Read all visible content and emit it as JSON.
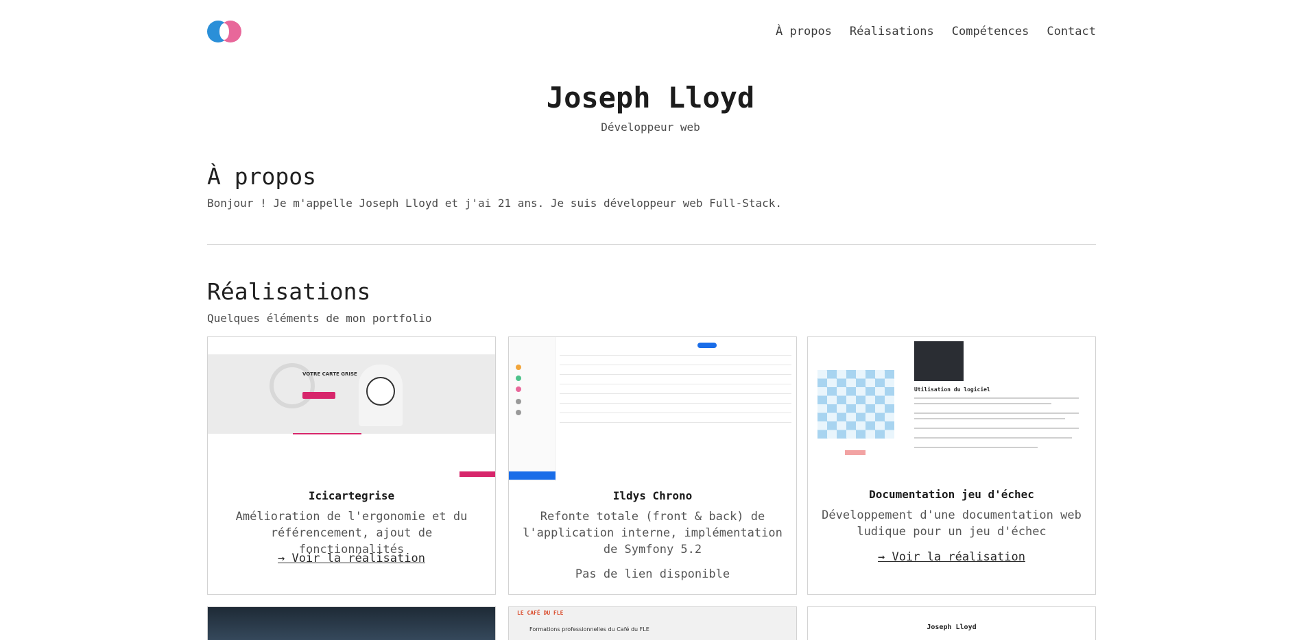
{
  "header": {
    "nav": [
      "À propos",
      "Réalisations",
      "Compétences",
      "Contact"
    ],
    "logo_colors": [
      "#2a8fd8",
      "#e8679a"
    ]
  },
  "hero": {
    "name": "Joseph Lloyd",
    "role": "Développeur web"
  },
  "about": {
    "title": "À propos",
    "text": "Bonjour ! Je m'appelle Joseph Lloyd et j'ai 21 ans. Je suis développeur web Full-Stack."
  },
  "works": {
    "title": "Réalisations",
    "subtitle": "Quelques éléments de mon portfolio",
    "cards": [
      {
        "title": "Icicartegrise",
        "desc": "Amélioration de l'ergonomie et du référencement, ajout de fonctionnalités",
        "link": "→ Voir la réalisation"
      },
      {
        "title": "Ildys Chrono",
        "desc": "Refonte totale (front & back) de l'application interne, implémentation de Symfony 5.2",
        "nolink": "Pas de lien disponible"
      },
      {
        "title": "Documentation jeu d'échec",
        "desc": "Développement d'une documentation web ludique pour un jeu d'échec",
        "link": "→ Voir la réalisation"
      }
    ],
    "thumbs": {
      "t1_hero_title": "VOTRE CARTE GRISE",
      "t3_heading": "Utilisation du logiciel",
      "b2_brand": "LE CAFÉ DU FLE",
      "b2_heading": "Formations professionnelles du Café du FLE",
      "b3_name": "Joseph Lloyd"
    }
  }
}
